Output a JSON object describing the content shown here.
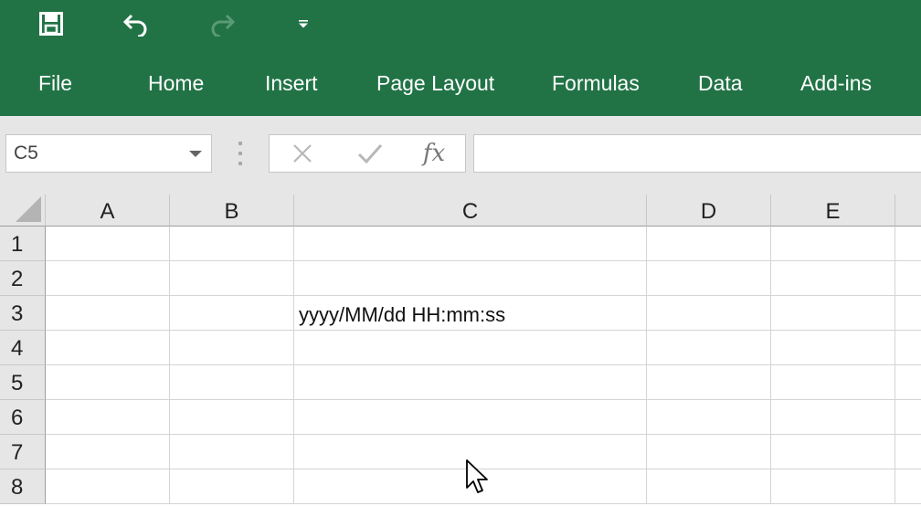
{
  "quick_access": {
    "save_icon": "save-icon",
    "undo_icon": "undo-icon",
    "redo_icon": "redo-icon",
    "customize_icon": "customize-qat-icon"
  },
  "ribbon_tabs": [
    "File",
    "Home",
    "Insert",
    "Page Layout",
    "Formulas",
    "Data",
    "Add-ins"
  ],
  "formula_bar": {
    "name_box": "C5",
    "fx_label": "fx",
    "formula_value": ""
  },
  "sheet": {
    "columns": [
      "A",
      "B",
      "C",
      "D",
      "E"
    ],
    "rows": [
      "1",
      "2",
      "3",
      "4",
      "5",
      "6",
      "7",
      "8"
    ],
    "cells": {
      "C3": "yyyy/MM/dd HH:mm:ss"
    }
  },
  "colors": {
    "ribbon": "#217346",
    "header_bg": "#e6e6e6",
    "gridline": "#d4d4d4"
  }
}
